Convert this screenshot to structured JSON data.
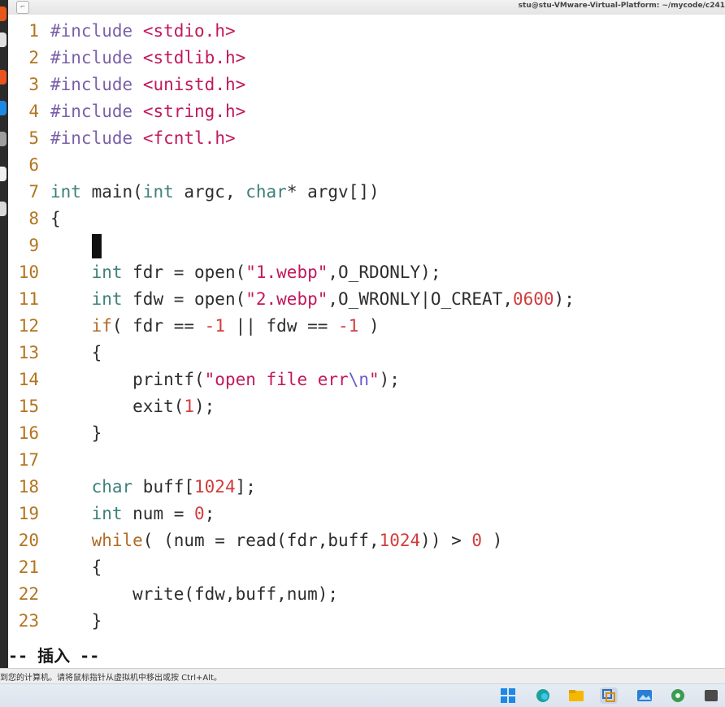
{
  "window": {
    "title": "stu@stu-VMware-Virtual-Platform: ~/mycode/c241",
    "menu_icon": "window-menu-icon"
  },
  "code": [
    {
      "ln": "1",
      "tokens": [
        {
          "t": "#include",
          "c": "pp"
        },
        {
          "t": " ",
          "c": ""
        },
        {
          "t": "<stdio.h>",
          "c": "hdr"
        }
      ]
    },
    {
      "ln": "2",
      "tokens": [
        {
          "t": "#include",
          "c": "pp"
        },
        {
          "t": " ",
          "c": ""
        },
        {
          "t": "<stdlib.h>",
          "c": "hdr"
        }
      ]
    },
    {
      "ln": "3",
      "tokens": [
        {
          "t": "#include",
          "c": "pp"
        },
        {
          "t": " ",
          "c": ""
        },
        {
          "t": "<unistd.h>",
          "c": "hdr"
        }
      ]
    },
    {
      "ln": "4",
      "tokens": [
        {
          "t": "#include",
          "c": "pp"
        },
        {
          "t": " ",
          "c": ""
        },
        {
          "t": "<string.h>",
          "c": "hdr"
        }
      ]
    },
    {
      "ln": "5",
      "tokens": [
        {
          "t": "#include",
          "c": "pp"
        },
        {
          "t": " ",
          "c": ""
        },
        {
          "t": "<fcntl.h>",
          "c": "hdr"
        }
      ]
    },
    {
      "ln": "6",
      "tokens": []
    },
    {
      "ln": "7",
      "tokens": [
        {
          "t": "int",
          "c": "ty"
        },
        {
          "t": " main(",
          "c": ""
        },
        {
          "t": "int",
          "c": "ty"
        },
        {
          "t": " argc, ",
          "c": ""
        },
        {
          "t": "char",
          "c": "ty"
        },
        {
          "t": "* argv[]",
          "c": ""
        },
        {
          "t": ")",
          "c": ""
        }
      ]
    },
    {
      "ln": "8",
      "tokens": [
        {
          "t": "{",
          "c": ""
        }
      ]
    },
    {
      "ln": "9",
      "tokens": [
        {
          "t": "    ",
          "c": ""
        }
      ],
      "cursor": true
    },
    {
      "ln": "10",
      "tokens": [
        {
          "t": "    ",
          "c": ""
        },
        {
          "t": "int",
          "c": "ty"
        },
        {
          "t": " fdr = open(",
          "c": ""
        },
        {
          "t": "\"1.webp\"",
          "c": "str"
        },
        {
          "t": ",O_RDONLY);",
          "c": ""
        }
      ]
    },
    {
      "ln": "11",
      "tokens": [
        {
          "t": "    ",
          "c": ""
        },
        {
          "t": "int",
          "c": "ty"
        },
        {
          "t": " fdw = open(",
          "c": ""
        },
        {
          "t": "\"2.webp\"",
          "c": "str"
        },
        {
          "t": ",O_WRONLY|O_CREAT,",
          "c": ""
        },
        {
          "t": "0600",
          "c": "num"
        },
        {
          "t": ");",
          "c": ""
        }
      ]
    },
    {
      "ln": "12",
      "tokens": [
        {
          "t": "    ",
          "c": ""
        },
        {
          "t": "if",
          "c": "kw"
        },
        {
          "t": "( fdr == ",
          "c": ""
        },
        {
          "t": "-1",
          "c": "num"
        },
        {
          "t": " || fdw == ",
          "c": ""
        },
        {
          "t": "-1",
          "c": "num"
        },
        {
          "t": " )",
          "c": ""
        }
      ]
    },
    {
      "ln": "13",
      "tokens": [
        {
          "t": "    {",
          "c": ""
        }
      ]
    },
    {
      "ln": "14",
      "tokens": [
        {
          "t": "        printf(",
          "c": ""
        },
        {
          "t": "\"open file err",
          "c": "str"
        },
        {
          "t": "\\n",
          "c": "esc"
        },
        {
          "t": "\"",
          "c": "str"
        },
        {
          "t": ");",
          "c": ""
        }
      ]
    },
    {
      "ln": "15",
      "tokens": [
        {
          "t": "        exit(",
          "c": ""
        },
        {
          "t": "1",
          "c": "num"
        },
        {
          "t": ");",
          "c": ""
        }
      ]
    },
    {
      "ln": "16",
      "tokens": [
        {
          "t": "    }",
          "c": ""
        }
      ]
    },
    {
      "ln": "17",
      "tokens": []
    },
    {
      "ln": "18",
      "tokens": [
        {
          "t": "    ",
          "c": ""
        },
        {
          "t": "char",
          "c": "ty"
        },
        {
          "t": " buff[",
          "c": ""
        },
        {
          "t": "1024",
          "c": "num"
        },
        {
          "t": "];",
          "c": ""
        }
      ]
    },
    {
      "ln": "19",
      "tokens": [
        {
          "t": "    ",
          "c": ""
        },
        {
          "t": "int",
          "c": "ty"
        },
        {
          "t": " num = ",
          "c": ""
        },
        {
          "t": "0",
          "c": "num"
        },
        {
          "t": ";",
          "c": ""
        }
      ]
    },
    {
      "ln": "20",
      "tokens": [
        {
          "t": "    ",
          "c": ""
        },
        {
          "t": "while",
          "c": "kw"
        },
        {
          "t": "( (num = read(fdr,buff,",
          "c": ""
        },
        {
          "t": "1024",
          "c": "num"
        },
        {
          "t": ")) > ",
          "c": ""
        },
        {
          "t": "0",
          "c": "num"
        },
        {
          "t": " )",
          "c": ""
        }
      ]
    },
    {
      "ln": "21",
      "tokens": [
        {
          "t": "    {",
          "c": ""
        }
      ]
    },
    {
      "ln": "22",
      "tokens": [
        {
          "t": "        write(fdw,buff,num);",
          "c": ""
        }
      ]
    },
    {
      "ln": "23",
      "tokens": [
        {
          "t": "    }",
          "c": ""
        }
      ]
    }
  ],
  "mode_line": "-- 插入 --",
  "vm_notice": "到您的计算机。请将鼠标指针从虚拟机中移出或按 Ctrl+Alt。",
  "taskbar": {
    "icons": [
      "windows-start-icon",
      "edge-browser-icon",
      "file-explorer-icon",
      "vmware-icon",
      "photos-icon",
      "control-panel-icon",
      "app-icon"
    ],
    "colors": {
      "start": "#1e88e5",
      "edge": "#1ba39c",
      "explorer": "#f5b800",
      "vmware": "#2f6fb3",
      "photos": "#2a7fd4",
      "control": "#3c9b50",
      "app": "#4a4a4a"
    }
  }
}
